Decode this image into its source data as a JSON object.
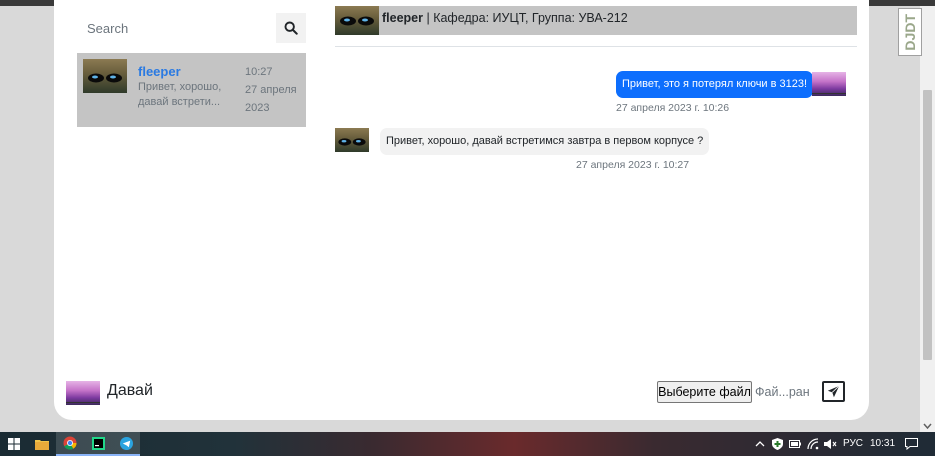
{
  "search": {
    "placeholder": "Search",
    "icon": "search-icon"
  },
  "contacts": [
    {
      "name": "fleeper",
      "preview": "Привет, хорошо, давай встрети...",
      "time": "10:27",
      "date": "27 апреля 2023"
    }
  ],
  "chat_header": {
    "name": "fleeper",
    "details": " | Кафедра: ИУЦТ, Группа: УВА-212"
  },
  "messages": [
    {
      "direction": "out",
      "text": "Привет, это я потерял ключи в 3123!",
      "timestamp": "27 апреля 2023 г. 10:26"
    },
    {
      "direction": "in",
      "text": "Привет, хорошо, давай встретимся завтра в первом корпусе ?",
      "timestamp": "27 апреля 2023 г. 10:27"
    }
  ],
  "composer": {
    "text": "Давай",
    "file_button": "Выберите файл",
    "file_name": "Фай...ран",
    "send_icon": "paper-plane-icon"
  },
  "extension": {
    "label": "DJDT"
  },
  "taskbar": {
    "language": "РУС",
    "clock": "10:31",
    "apps": [
      "windows-start",
      "file-explorer",
      "chrome",
      "pycharm",
      "telegram"
    ]
  },
  "colors": {
    "accent": "#0d6efd",
    "name_link": "#2a7ae2",
    "panel_gray": "#c4c4c4"
  }
}
